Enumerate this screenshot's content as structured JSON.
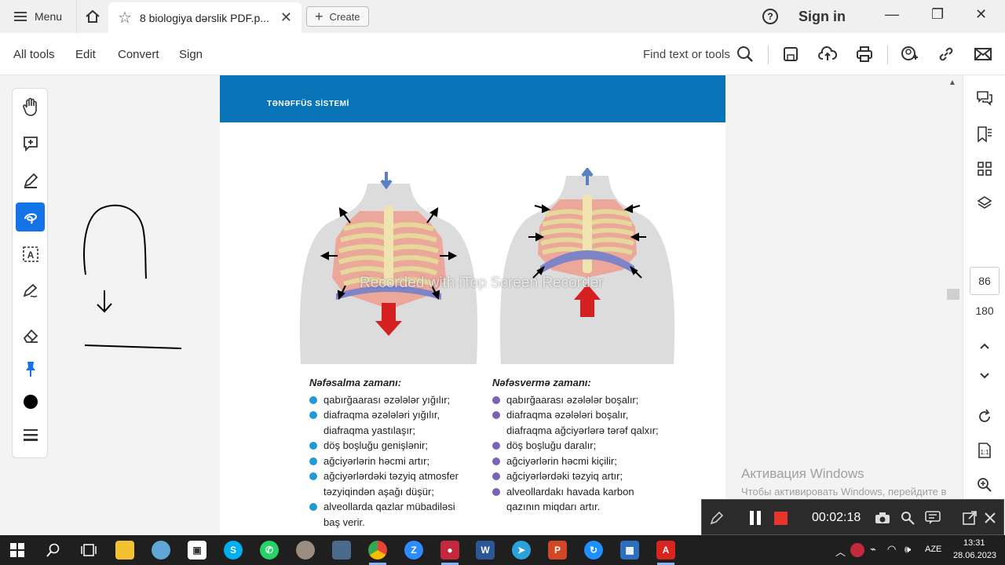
{
  "titlebar": {
    "menu_label": "Menu",
    "tab_title": "8 biologiya dərslik PDF.p...",
    "create_label": "Create",
    "help_label": "?",
    "signin_label": "Sign in"
  },
  "toolbar": {
    "items": [
      "All tools",
      "Edit",
      "Convert",
      "Sign"
    ],
    "find_label": "Find text or tools"
  },
  "page": {
    "header": "TƏNƏFFÜS SİSTEMİ",
    "watermark": "Recorded with iTop Screen Recorder",
    "inhale": {
      "title": "Nəfəsalma zamanı:",
      "dot_color": "#1f9ad6",
      "items": [
        "qabırğaarası əzələlər yığılır;",
        "diafraqma əzələləri yığılır, diafraqma yastılaşır;",
        "döş boşluğu genişlənir;",
        "ağciyərlərin həcmi artır;",
        "ağciyərlərdəki təzyiq atmosfer təzyiqindən aşağı düşür;",
        "alveollarda qazlar mübadiləsi baş verir."
      ]
    },
    "exhale": {
      "title": "Nəfəsvermə zamanı:",
      "dot_color": "#7b63b4",
      "items": [
        "qabırğaarası əzələlər boşalır;",
        "diafraqma əzələləri boşalır, diafraqma ağciyərlərə tərəf qalxır;",
        "döş boşluğu daralır;",
        "ağciyərlərin həcmi kiçilir;",
        "ağciyərlərdəki təzyiq artır;",
        "alveollardakı havada karbon qazının miqdarı artır."
      ]
    }
  },
  "rightpanel": {
    "page_number": "86",
    "page_total": "180"
  },
  "activation": {
    "title": "Активация Windows",
    "line": "Чтобы активировать Windows, перейдите в раздел \"Параметры\"."
  },
  "recorder": {
    "timer": "00:02:18"
  },
  "taskbar": {
    "language": "AZE",
    "time": "13:31",
    "date": "28.06.2023"
  },
  "colors": {
    "accent": "#1473e6",
    "page_header": "#0a74b8",
    "inhale_arrow": "#d42020",
    "exhale_arrow": "#d42020"
  }
}
